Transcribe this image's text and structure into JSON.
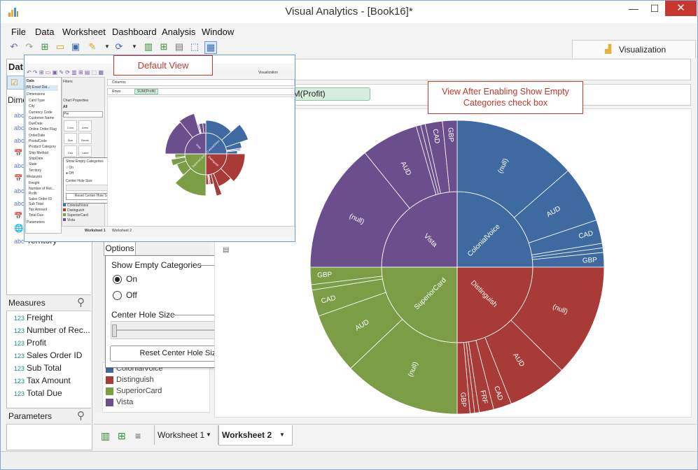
{
  "window": {
    "title": "Visual Analytics - [Book16]*",
    "minimize": "—",
    "maximize": "☐",
    "close": "✕"
  },
  "menu": [
    "File",
    "Data",
    "Worksheet",
    "Dashboard",
    "Analysis",
    "Window"
  ],
  "toolbar": {
    "visualization_tab": "Visualization"
  },
  "left_pane": {
    "data_header": "Dat",
    "dimensions_header": "Dime",
    "dimension_fields": [
      {
        "icon": "abc",
        "label": ""
      },
      {
        "icon": "abc",
        "label": ""
      },
      {
        "icon": "abc",
        "label": ""
      },
      {
        "icon": "date",
        "label": ""
      },
      {
        "icon": "abc",
        "label": ""
      },
      {
        "icon": "date",
        "label": ""
      },
      {
        "icon": "abc",
        "label": ""
      },
      {
        "icon": "abc",
        "label": ""
      },
      {
        "icon": "date",
        "label": ""
      },
      {
        "icon": "globe",
        "label": "State"
      },
      {
        "icon": "abc",
        "label": "Territory"
      }
    ],
    "measures_header": "Measures",
    "measure_fields": [
      {
        "icon": "123",
        "label": "Freight"
      },
      {
        "icon": "123",
        "label": "Number of Rec..."
      },
      {
        "icon": "123",
        "label": "Profit"
      },
      {
        "icon": "123",
        "label": "Sales Order ID"
      },
      {
        "icon": "123",
        "label": "Sub Total"
      },
      {
        "icon": "123",
        "label": "Tax Amount"
      },
      {
        "icon": "123",
        "label": "Total Due"
      }
    ],
    "parameters_header": "Parameters"
  },
  "options": {
    "button": "Options",
    "show_empty_label": "Show Empty Categories",
    "on_label": "On",
    "off_label": "Off",
    "selected": "On",
    "center_hole_label": "Center Hole Size",
    "center_hole_value": 0,
    "reset_button": "Reset Center Hole Size"
  },
  "legend": {
    "items": [
      {
        "label": "ColonialVoice",
        "color": "#3f6aa1"
      },
      {
        "label": "Distinguish",
        "color": "#a83a38"
      },
      {
        "label": "SuperiorCard",
        "color": "#7b9d45"
      },
      {
        "label": "Vista",
        "color": "#6a4f8c"
      }
    ]
  },
  "rows_shelf": {
    "pill": "SUM(Profit)",
    "pill_visible": "UM(Profit)"
  },
  "callouts": {
    "default_view": "Default View",
    "after_view": "View After Enabling Show Empty Categories check box"
  },
  "worksheet_tabs": [
    "Worksheet 1",
    "Worksheet 2"
  ],
  "active_tab": "Worksheet 2",
  "inset": {
    "menu": [
      "File",
      "Data",
      "Worksheet",
      "Dashboard",
      "Analysis",
      "Window"
    ],
    "visualization": "Visualization",
    "data_item": "(M) Excel Dat...",
    "dimensions": "Dimensions",
    "dim_fields": [
      "Card Type",
      "City",
      "Currency Code",
      "Customer Name",
      "DueDate",
      "Online Order Flag",
      "OrderDate",
      "PostalCode",
      "Product Category",
      "Ship Method",
      "ShipDate",
      "State",
      "Territory"
    ],
    "measures": "Measures",
    "measure_fields": [
      "Freight",
      "Number of Rec...",
      "Profit",
      "Sales Order ID",
      "Sub Total",
      "Tax Amount",
      "Total Due"
    ],
    "parameters": "Parameters",
    "filters": "Filters",
    "chart_props": "Chart Properties",
    "all": "All",
    "pie": "Pie",
    "props_buttons": [
      "Color",
      "Axes",
      "Size",
      "Break",
      "Geo",
      "Label",
      "Options"
    ],
    "columns": "Columns",
    "rows": "Rows",
    "rows_pill": "SUM(Profit)",
    "show_empty": "Show Empty Categories",
    "on": "On",
    "off": "Off",
    "center_hole": "Center Hole Size",
    "reset": "Reset Center Hole Size",
    "legend": [
      "ColonialVoice",
      "Distinguish",
      "SuperiorCard",
      "Vista"
    ],
    "tabs": [
      "Worksheet 1",
      "Worksheet 2"
    ],
    "inner_labels": [
      "ColonialVoice",
      "Distinguish",
      "SuperiorCard",
      "Vista"
    ],
    "outer_labels": [
      "AUD",
      "CAD",
      "GBP",
      "AUD",
      "CAD",
      "GBP",
      "AUD"
    ]
  },
  "chart_data": {
    "type": "sunburst",
    "inner": [
      {
        "name": "ColonialVoice",
        "color": "#3f6aa1",
        "value": 25
      },
      {
        "name": "Distinguish",
        "color": "#a83a38",
        "value": 25
      },
      {
        "name": "SuperiorCard",
        "color": "#7b9d45",
        "value": 25
      },
      {
        "name": "Vista",
        "color": "#6a4f8c",
        "value": 25
      }
    ],
    "outer": [
      {
        "parent": "ColonialVoice",
        "label": "(null)",
        "value": 13.6
      },
      {
        "parent": "ColonialVoice",
        "label": "AUD",
        "value": 6.2
      },
      {
        "parent": "ColonialVoice",
        "label": "CAD",
        "value": 2.6
      },
      {
        "parent": "ColonialVoice",
        "label": "",
        "value": 0.5
      },
      {
        "parent": "ColonialVoice",
        "label": "",
        "value": 0.5
      },
      {
        "parent": "ColonialVoice",
        "label": "GBP",
        "value": 1.6
      },
      {
        "parent": "Distinguish",
        "label": "(null)",
        "value": 12.4
      },
      {
        "parent": "Distinguish",
        "label": "AUD",
        "value": 6.6
      },
      {
        "parent": "Distinguish",
        "label": "CAD",
        "value": 2.0
      },
      {
        "parent": "Distinguish",
        "label": "FRF",
        "value": 1.6
      },
      {
        "parent": "Distinguish",
        "label": "",
        "value": 0.5
      },
      {
        "parent": "Distinguish",
        "label": "",
        "value": 0.5
      },
      {
        "parent": "Distinguish",
        "label": "GBP",
        "value": 1.4
      },
      {
        "parent": "SuperiorCard",
        "label": "(null)",
        "value": 12.9
      },
      {
        "parent": "SuperiorCard",
        "label": "AUD",
        "value": 6.7
      },
      {
        "parent": "SuperiorCard",
        "label": "CAD",
        "value": 2.9
      },
      {
        "parent": "SuperiorCard",
        "label": "",
        "value": 0.6
      },
      {
        "parent": "SuperiorCard",
        "label": "GBP",
        "value": 1.9
      },
      {
        "parent": "Vista",
        "label": "(null)",
        "value": 14.2
      },
      {
        "parent": "Vista",
        "label": "AUD",
        "value": 6.3
      },
      {
        "parent": "Vista",
        "label": "",
        "value": 0.5
      },
      {
        "parent": "Vista",
        "label": "",
        "value": 0.5
      },
      {
        "parent": "Vista",
        "label": "CAD",
        "value": 1.9
      },
      {
        "parent": "Vista",
        "label": "GBP",
        "value": 1.6
      }
    ]
  }
}
